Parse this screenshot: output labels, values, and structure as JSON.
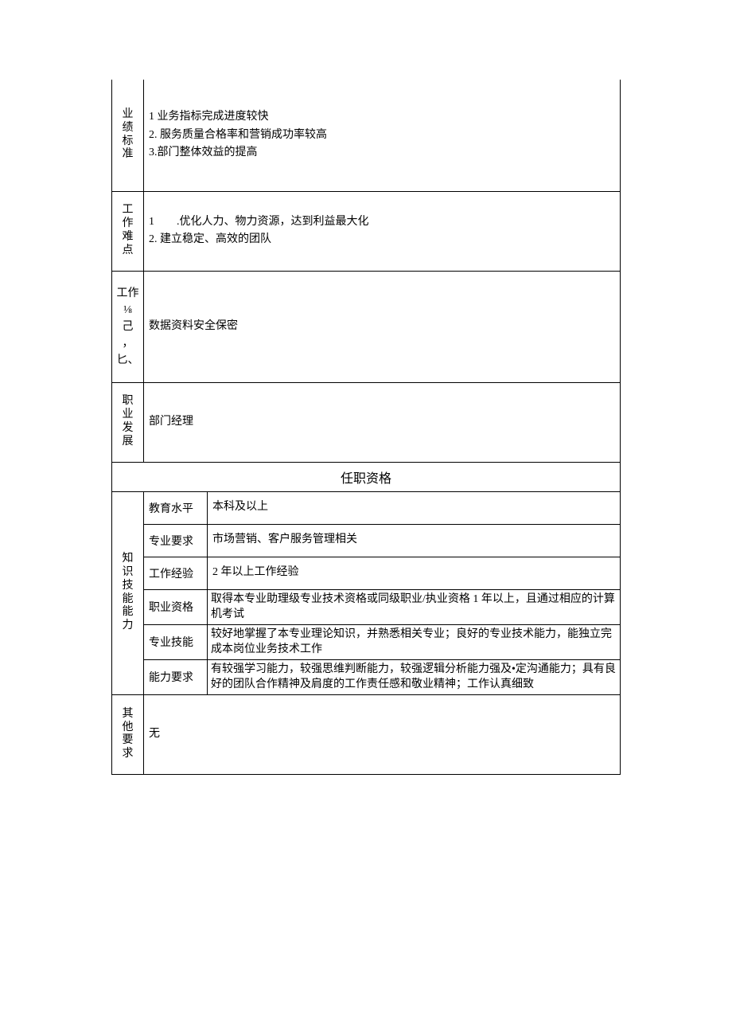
{
  "rows": {
    "performance": {
      "label": "业绩标准",
      "content": "1 业务指标完成进度较快\n2. 服务质量合格率和营销成功率较高\n3.部门整体效益的提高"
    },
    "difficulty": {
      "label": "工作难点",
      "content": "1　　.优化人力、物力资源，达到利益最大化\n2. 建立稳定、高效的团队"
    },
    "work_etc": {
      "label": "工作\n⅛\n己\n，\n匕、",
      "content": "数据资料安全保密"
    },
    "career": {
      "label": "职业发展",
      "content": "部门经理"
    }
  },
  "qualification_header": "任职资格",
  "knowledge_label": "知识技能能力",
  "qualifications": {
    "education": {
      "label": "教育水平",
      "value": "本科及以上"
    },
    "major": {
      "label": "专业要求",
      "value": "市场营销、客户服务管理相关"
    },
    "experience": {
      "label": "工作经验",
      "value": "2 年以上工作经验"
    },
    "cert": {
      "label": "职业资格",
      "value": "取得本专业助理级专业技术资格或同级职业/执业资格 1 年以上，且通过相应的计算机考试"
    },
    "skills": {
      "label": "专业技能",
      "value": "较好地掌握了本专业理论知识，并熟悉相关专业；良好的专业技术能力，能独立完成本岗位业务技术工作"
    },
    "ability": {
      "label": "能力要求",
      "value": "有较强学习能力，较强思维判断能力，较强逻辑分析能力强及•定沟通能力；具有良好的团队合作精神及肩度的工作责任感和敬业精神；工作认真细致"
    }
  },
  "other": {
    "label": "其他要求",
    "value": "无"
  }
}
